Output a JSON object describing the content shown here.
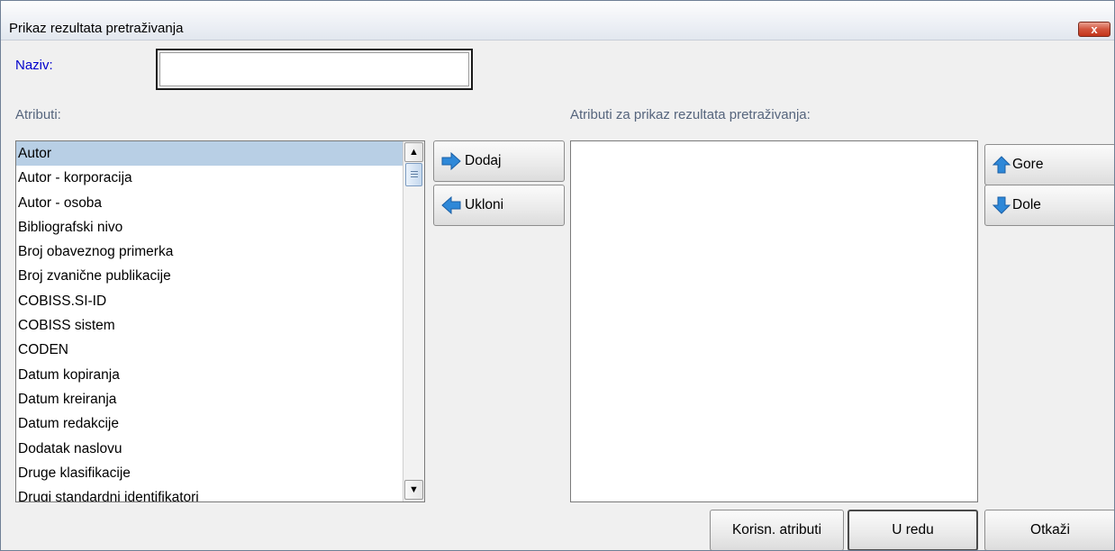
{
  "window": {
    "title": "Prikaz rezultata pretraživanja",
    "close_glyph": "x"
  },
  "form": {
    "name_label": "Naziv:",
    "name_value": "",
    "attributes_label": "Atributi:",
    "selected_attributes_label": "Atributi za prikaz rezultata pretraživanja:"
  },
  "attributes": {
    "items": [
      "Autor",
      "Autor - korporacija",
      "Autor - osoba",
      "Bibliografski nivo",
      "Broj obaveznog primerka",
      "Broj zvanične publikacije",
      "COBISS.SI-ID",
      "COBISS sistem",
      "CODEN",
      "Datum kopiranja",
      "Datum kreiranja",
      "Datum redakcije",
      "Dodatak naslovu",
      "Druge klasifikacije",
      "Drugi standardni identifikatori"
    ],
    "selected_item": "Autor"
  },
  "selected_attributes": {
    "items": []
  },
  "buttons": {
    "add": "Dodaj",
    "remove": "Ukloni",
    "up": "Gore",
    "down": "Dole",
    "user_attributes": "Korisn. atributi",
    "ok": "U redu",
    "cancel": "Otkaži"
  },
  "icons": {
    "add": "arrow-right-icon",
    "remove": "arrow-left-icon",
    "up": "arrow-up-icon",
    "down": "arrow-down-icon",
    "scroll_up": "scroll-up-icon",
    "scroll_down": "scroll-down-icon"
  },
  "colors": {
    "label_blue": "#0000cc",
    "label_grey": "#56657d",
    "selection": "#b8cfe5",
    "arrow_icon": "#2e88d8"
  }
}
